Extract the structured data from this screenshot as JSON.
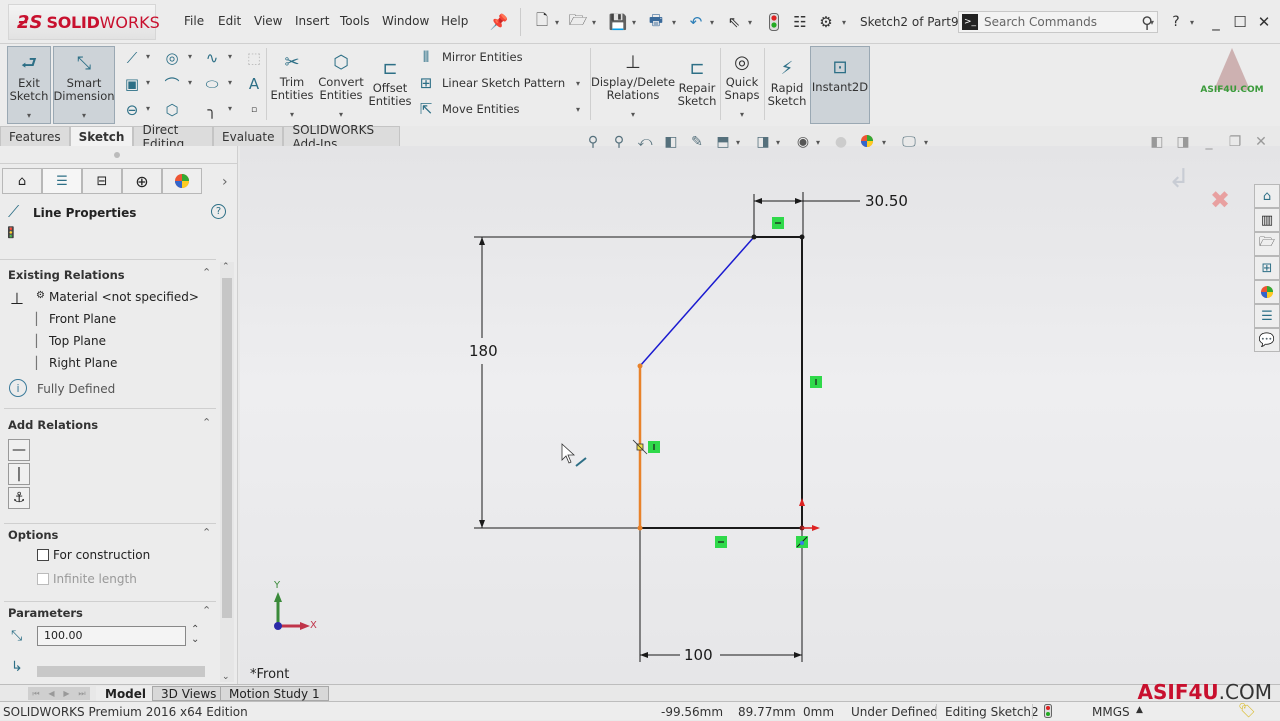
{
  "app": {
    "logo_prefix": "3S",
    "logo_bold": "SOLID",
    "logo_light": "WORKS",
    "document_title": "Sketch2 of Part9 *"
  },
  "menu": [
    "File",
    "Edit",
    "View",
    "Insert",
    "Tools",
    "Window",
    "Help"
  ],
  "search": {
    "placeholder": "Search Commands"
  },
  "ribbon": {
    "exit_sketch": "Exit\nSketch",
    "exit_sketch_l1": "Exit",
    "exit_sketch_l2": "Sketch",
    "smart_dim_l1": "Smart",
    "smart_dim_l2": "Dimension",
    "trim_l1": "Trim",
    "trim_l2": "Entities",
    "convert_l1": "Convert",
    "convert_l2": "Entities",
    "offset_l1": "Offset",
    "offset_l2": "Entities",
    "mirror": "Mirror Entities",
    "linear_pattern": "Linear Sketch Pattern",
    "move": "Move Entities",
    "display_delete_l1": "Display/Delete",
    "display_delete_l2": "Relations",
    "repair_l1": "Repair",
    "repair_l2": "Sketch",
    "quick_snaps_l1": "Quick",
    "quick_snaps_l2": "Snaps",
    "rapid_l1": "Rapid",
    "rapid_l2": "Sketch",
    "instant2d": "Instant2D"
  },
  "tabs": [
    {
      "label": "Features",
      "active": false
    },
    {
      "label": "Sketch",
      "active": true
    },
    {
      "label": "Direct Editing",
      "active": false
    },
    {
      "label": "Evaluate",
      "active": false
    },
    {
      "label": "SOLIDWORKS Add-Ins",
      "active": false
    }
  ],
  "property_manager": {
    "title": "Line Properties",
    "existing_relations": {
      "heading": "Existing Relations",
      "items": [
        "Material <not specified>",
        "Front Plane",
        "Top Plane",
        "Right Plane"
      ],
      "status": "Fully Defined"
    },
    "add_relations": {
      "heading": "Add Relations",
      "buttons": [
        "horizontal",
        "vertical",
        "fix"
      ]
    },
    "options": {
      "heading": "Options",
      "for_construction": {
        "label": "For construction",
        "checked": false
      },
      "infinite_length": {
        "label": "Infinite length",
        "checked": false,
        "disabled": true
      }
    },
    "parameters": {
      "heading": "Parameters",
      "length_value": "100.00"
    }
  },
  "sketch": {
    "dimensions": {
      "top": "30.50",
      "left": "180",
      "bottom": "100"
    },
    "view_label": "*Front",
    "axis_x": "X",
    "axis_y": "Y",
    "colors": {
      "selected_line": "#e8822a",
      "blue_line": "#1a1ad0",
      "relation_badge": "#2fd94a",
      "black_line": "#1a1a1a"
    }
  },
  "bottom_tabs": [
    {
      "label": "Model",
      "active": true
    },
    {
      "label": "3D Views",
      "active": false
    },
    {
      "label": "Motion Study 1",
      "active": false
    }
  ],
  "status": {
    "edition": "SOLIDWORKS Premium 2016 x64 Edition",
    "x": "-99.56mm",
    "y": "89.77mm",
    "z": "0mm",
    "definition": "Under Defined",
    "editing": "Editing Sketch2",
    "units": "MMGS"
  },
  "watermark": {
    "main": "ASIF4U",
    "suffix": ".COM"
  }
}
